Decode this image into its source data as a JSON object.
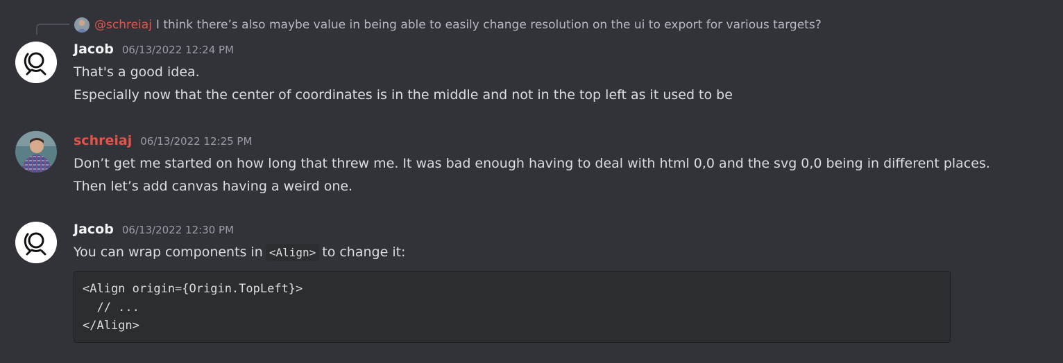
{
  "reply": {
    "mention": "@schreiaj",
    "text": "I think there’s also maybe value in being able to easily change resolution on the ui to export for various targets?"
  },
  "messages": [
    {
      "username": "Jacob",
      "timestamp": "06/13/2022 12:24 PM",
      "lines": [
        "That's a good idea.",
        "Especially now that the center of coordinates is in the middle and not in the top left as it used to be"
      ]
    },
    {
      "username": "schreiaj",
      "timestamp": "06/13/2022 12:25 PM",
      "lines": [
        "Don’t get me started on how long that threw me. It was bad enough having to deal with html 0,0 and the svg 0,0 being in different places.",
        "Then let’s add canvas having a weird one."
      ]
    },
    {
      "username": "Jacob",
      "timestamp": "06/13/2022 12:30 PM",
      "text_before": "You can wrap components in",
      "inline_code": "<Align>",
      "text_after": "to change it:",
      "code_lines": [
        "<Align origin={Origin.TopLeft}>",
        "  // ...",
        "</Align>"
      ]
    }
  ],
  "colors": {
    "background": "#313338",
    "mention": "#e5534b",
    "username_red": "#e5534b",
    "code_background": "#2b2d31"
  },
  "icons": {
    "jacob_avatar": "motion-canvas-logo-icon",
    "schreiaj_avatar": "user-photo-avatar"
  }
}
